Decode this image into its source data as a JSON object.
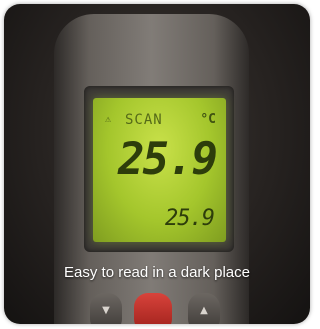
{
  "display": {
    "warning_glyph": "⚠",
    "mode": "SCAN",
    "unit": "°C",
    "main_reading": "25.9",
    "secondary_reading": "25.9"
  },
  "caption": "Easy to read in a dark place",
  "buttons": {
    "down_glyph": "▼",
    "up_glyph": "▲"
  },
  "colors": {
    "lcd_backlight": "#b4d13a",
    "trigger_button": "#c8302a"
  }
}
